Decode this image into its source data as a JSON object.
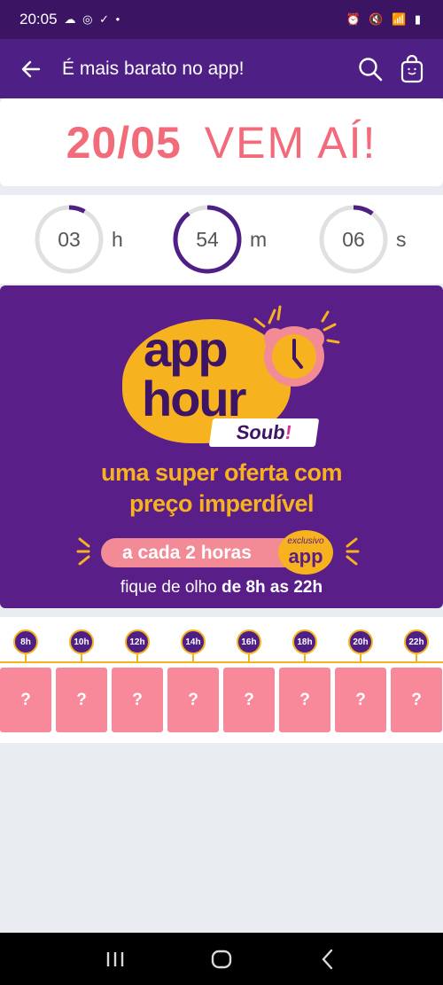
{
  "status_bar": {
    "time": "20:05",
    "left_icons": "☁ ◎ ✓ •",
    "right_icons": "⏰ 🔇 📶 ▮"
  },
  "app_bar": {
    "title": "É mais barato no app!",
    "back_icon": "arrow-left-icon",
    "search_icon": "search-icon",
    "bag_icon": "shopping-bag-icon"
  },
  "headline": {
    "date": "20/05",
    "text": "VEM AÍ!"
  },
  "countdown": {
    "items": [
      {
        "value": "03",
        "unit": "h",
        "progress": 0.08
      },
      {
        "value": "54",
        "unit": "m",
        "progress": 0.9
      },
      {
        "value": "06",
        "unit": "s",
        "progress": 0.1
      }
    ],
    "colors": {
      "track": "#e0e0e0",
      "fill": "#4e1f85"
    }
  },
  "banner": {
    "app": "app",
    "hour": "hour",
    "brand": "Soub",
    "brand_bang": "!",
    "tagline_1": "uma super oferta com",
    "tagline_2": "preço imperdível",
    "pill_text": "a cada 2 horas",
    "exclusive_small": "exclusivo",
    "exclusive_big": "app",
    "footnote_prefix": "fique de olho ",
    "footnote_bold": "de 8h as 22h"
  },
  "timeline": {
    "hours": [
      "8h",
      "10h",
      "12h",
      "14h",
      "16h",
      "18h",
      "20h",
      "22h"
    ],
    "card_label": "?"
  },
  "nav": {
    "recent": "recent-apps-icon",
    "home": "home-icon",
    "back": "back-icon"
  },
  "colors": {
    "purple_dark": "#3b1463",
    "purple": "#4e1f85",
    "banner": "#591e87",
    "yellow": "#f6b21f",
    "pink": "#f26b7a",
    "card_pink": "#f8899a"
  }
}
